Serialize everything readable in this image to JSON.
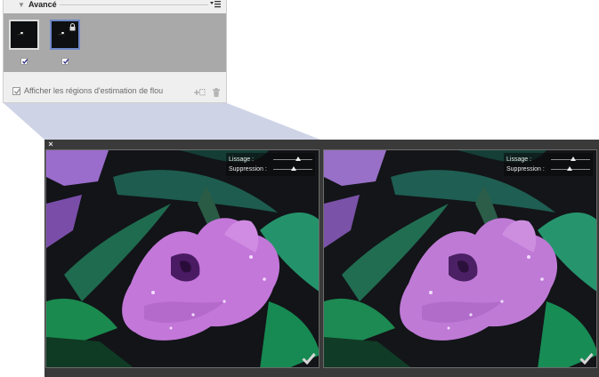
{
  "panel": {
    "title": "Avancé",
    "menu_icon": "panel-menu-icon",
    "thumbnails": [
      {
        "name": "blur-region-1",
        "checked": true,
        "locked": false,
        "selected": false
      },
      {
        "name": "blur-region-2",
        "checked": true,
        "locked": true,
        "selected": true
      }
    ],
    "show_regions_label": "Afficher les régions d'estimation de flou",
    "show_regions_checked": true,
    "add_icon": "add-region-icon",
    "delete_icon": "trash-icon"
  },
  "preview": {
    "close_label": "×",
    "panes": [
      {
        "smoothing_label": "Lissage :",
        "smoothing_value": 0.6,
        "suppression_label": "Suppression :",
        "suppression_value": 0.5
      },
      {
        "smoothing_label": "Lissage :",
        "smoothing_value": 0.55,
        "suppression_label": "Suppression :",
        "suppression_value": 0.45
      }
    ],
    "colors": {
      "selection": "#6d87c7",
      "frame": "#3a3a3a",
      "flower": "#c070d8",
      "leaf": "#1f8a4c"
    }
  }
}
